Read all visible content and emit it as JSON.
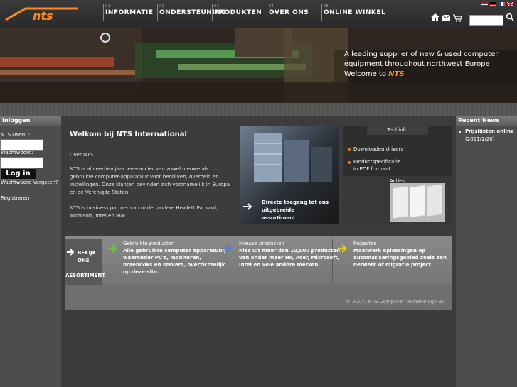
{
  "header": {
    "logo_text": "nts",
    "nav": [
      {
        "num": "01",
        "label": "INFORMATIE"
      },
      {
        "num": "02",
        "label": "ONDERSTEUNING"
      },
      {
        "num": "03",
        "label": "PRODUKTEN"
      },
      {
        "num": "04",
        "label": "OVER ONS"
      },
      {
        "num": "05",
        "label": "ONLINE WINKEL"
      }
    ],
    "search_value": ""
  },
  "banner": {
    "line1": "A leading supplier of new & used computer",
    "line2": "equipment throughout northwest Europe",
    "line3": "Welcome to",
    "brand": "NTS"
  },
  "login": {
    "title": "Inloggen",
    "userid_label": "NTS UserID:",
    "password_label": "Wachtwoord:",
    "button": "Log in",
    "forgot": "Wachtwoord Vergeten?",
    "register": "Registreren"
  },
  "news": {
    "title": "Recent News",
    "items": [
      {
        "title": "Prijslijsten online",
        "date": "(2011/1/20)"
      }
    ]
  },
  "main": {
    "welcome": "Welkom bij NTS International",
    "about_title": "Over NTS",
    "para1": [
      "NTS is al veertien jaar leverancier van zowel nieuwe als",
      "gebruikte computer-apparatuur voor bedrijven, overheid en",
      "instellingen. Onze klanten bevinden zich voornamelijk in Europa",
      "en de Verenigde Staten."
    ],
    "para2": [
      "NTS is business partner van onder andere Hewlett Packard,",
      "Microsoft, Intel en IBM."
    ]
  },
  "promo": {
    "main_text": [
      "Directe toegang tot ons",
      "uitgebreide",
      "assortiment"
    ],
    "techinfo": "Techinfo",
    "link1": "Downloaden drivers",
    "link2_line1": "Productspecificatie",
    "link2_line2": "in PDF formaat",
    "acties": "Acties"
  },
  "band": {
    "left": [
      "BEKIJK",
      "ONS",
      "ASSORTIMENT"
    ],
    "cells": [
      {
        "title": "Gebruikte producten",
        "lines": [
          "Alle gebruikte computer apparatuur,",
          "waaronder PC's, monitoren,",
          "notebooks en servers, overzichtelijk",
          "op deze site."
        ],
        "color": "#6cc644"
      },
      {
        "title": "Nieuwe producten",
        "lines": [
          "Kies uit meer dan 10,000 producten",
          "van onder meer HP, Acer, Microsoft,",
          "Intel en vele andere merken."
        ],
        "color": "#4a7fd9"
      },
      {
        "title": "Projecten",
        "lines": [
          "Maatwerk oplossingen op",
          "automatiseringsgebied zoals een",
          "netwerk of migratie project."
        ],
        "color": "#e8c91c"
      }
    ],
    "copyright": "© 2007, NTS Computer Techonology BV"
  },
  "colors": {
    "accent": "#ff8c1a"
  }
}
